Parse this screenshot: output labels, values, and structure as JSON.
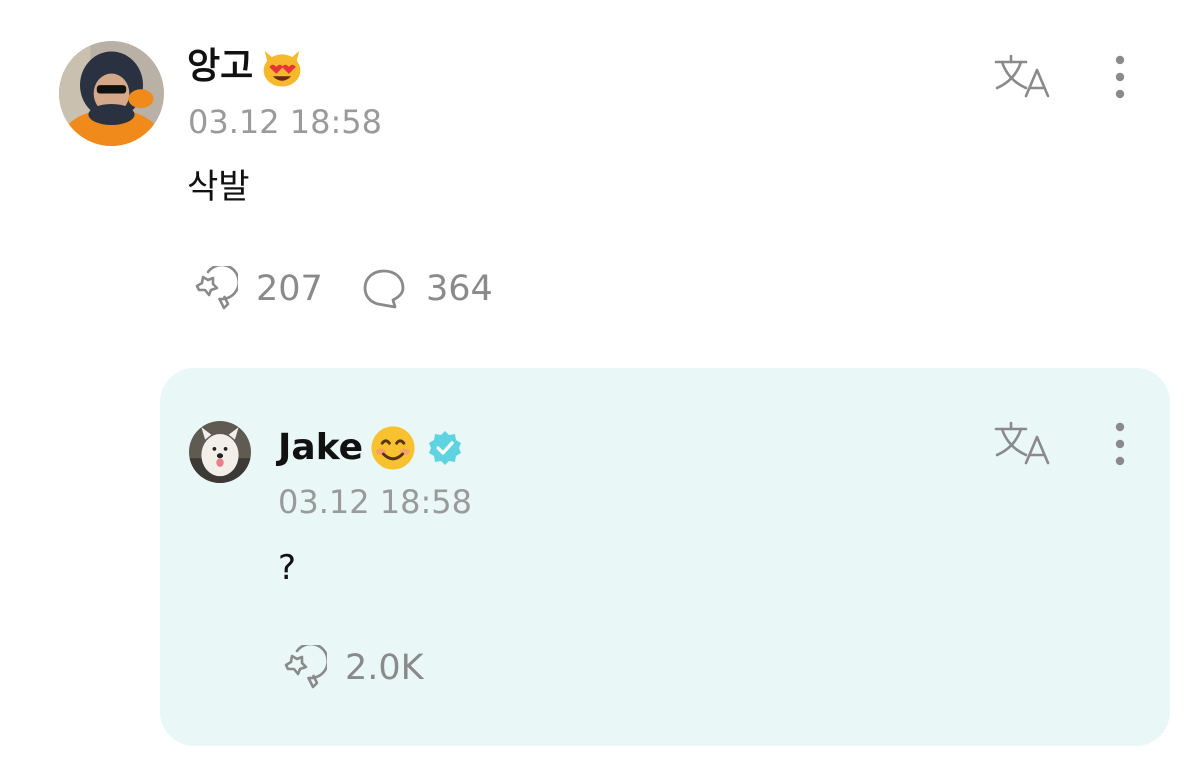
{
  "post": {
    "author": "앙고",
    "author_emoji": "smiling-cat-heart-eyes-emoji",
    "timestamp": "03.12 18:58",
    "text": "삭발",
    "reactions": "207",
    "comments": "364"
  },
  "reply": {
    "author": "Jake",
    "author_emoji": "smiling-face-emoji",
    "verified": true,
    "timestamp": "03.12 18:58",
    "text": "?",
    "reactions": "2.0K"
  },
  "colors": {
    "reply_background": "#e9f8f6",
    "verified_badge": "#5fd3e0",
    "muted_text": "#9a9a9a"
  }
}
